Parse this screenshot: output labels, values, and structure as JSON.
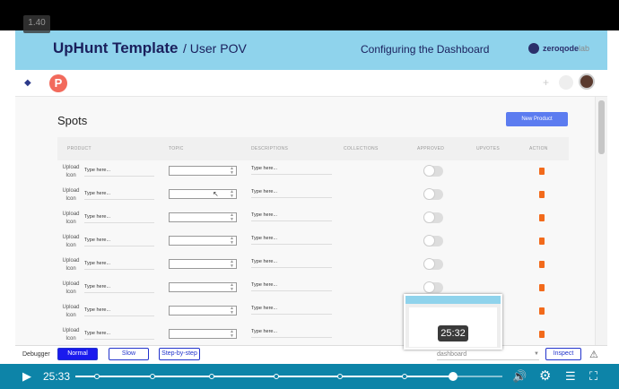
{
  "video": {
    "speed": "1.40",
    "current_time": "25:33",
    "preview_time": "25:32",
    "progress": 0.885
  },
  "banner": {
    "title": "UpHunt Template",
    "subtitle": "/ User POV",
    "topic": "Configuring the Dashboard",
    "brand_a": "zeroqode",
    "brand_b": "lab"
  },
  "app": {
    "logo_letter": "P",
    "page_title": "Spots",
    "new_button": "New Product"
  },
  "table": {
    "headers": [
      "PRODUCT",
      "TOPIC",
      "DESCRIPTIONS",
      "COLLECTIONS",
      "APPROVED",
      "UPVOTES",
      "ACTION"
    ],
    "upload_label": "Upload Icon",
    "placeholder": "Type here...",
    "rows": 8
  },
  "debugger": {
    "label": "Debugger",
    "normal": "Normal",
    "slow": "Slow",
    "step": "Step-by-step",
    "dropdown": "dashboard",
    "inspect": "Inspect"
  },
  "colors": {
    "banner": "#8fd3ec",
    "brand_dark": "#1a1f5c",
    "primary": "#5c7cf0",
    "player": "#0d84a8",
    "trash": "#f26a1b",
    "logo": "#f26a5c"
  },
  "icons": {
    "play": "play-icon",
    "volume": "volume-icon",
    "settings": "gear-icon",
    "chapters": "list-icon",
    "fullscreen": "fullscreen-icon",
    "warning": "warning-icon",
    "layers": "layers-icon"
  }
}
